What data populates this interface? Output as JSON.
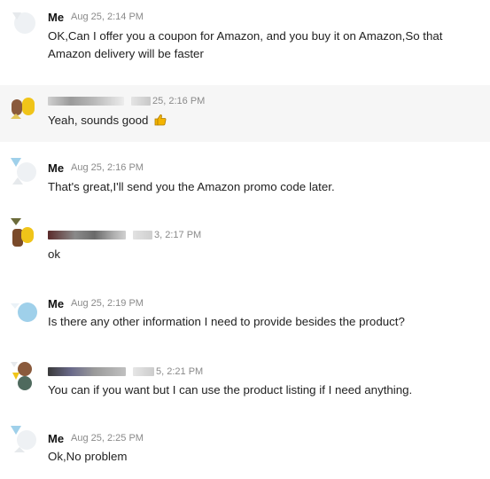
{
  "messages": [
    {
      "sender": "Me",
      "time": "Aug 25, 2:14 PM",
      "text": "OK,Can I offer you a coupon for Amazon, and you buy it on Amazon,So that Amazon delivery will be faster"
    },
    {
      "sender": "",
      "time": "25, 2:16 PM",
      "text": "Yeah, sounds good",
      "emoji": "thumbs-up"
    },
    {
      "sender": "Me",
      "time": "Aug 25, 2:16 PM",
      "text": "That's great,I'll send you the Amazon promo code later."
    },
    {
      "sender": "",
      "time": "3, 2:17 PM",
      "text": "ok"
    },
    {
      "sender": "Me",
      "time": "Aug 25, 2:19 PM",
      "text": "Is there any other information I need to provide besides the product?"
    },
    {
      "sender": "",
      "time": "5, 2:21 PM",
      "text": "You can if you want but I can use the product listing if I need anything."
    },
    {
      "sender": "Me",
      "time": "Aug 25, 2:25 PM",
      "text": "Ok,No problem"
    }
  ],
  "colors": {
    "highlight_bg": "#f6f6f6",
    "avatar_blue": "#9fd0ea",
    "avatar_yellow": "#f0c419",
    "avatar_brown": "#8a5a3c"
  }
}
